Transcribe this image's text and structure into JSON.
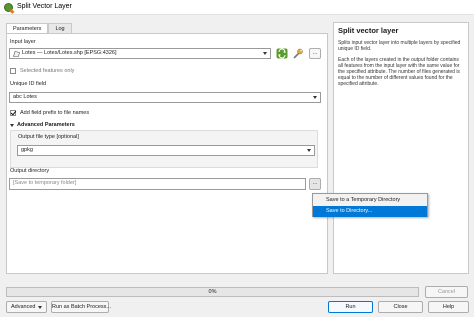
{
  "window": {
    "title": "Split Vector Layer"
  },
  "tabs": [
    {
      "label": "Parameters"
    },
    {
      "label": "Log"
    }
  ],
  "params": {
    "input_layer_label": "Input layer",
    "input_layer_value": "Lotes — Lotes/Lotes.shp [EPSG:4326]",
    "selected_only_label": "Selected features only",
    "unique_id_label": "Unique ID field",
    "unique_id_value": "Lotes",
    "field_type_tag": "abc",
    "add_prefix_label": "Add field prefix to file names",
    "advanced_label": "Advanced Parameters",
    "output_type_label": "Output file type [optional]",
    "output_type_value": "gpkg",
    "output_dir_label": "Output directory",
    "output_dir_placeholder": "[Save to temporary folder]",
    "browse_label": "…"
  },
  "menu": {
    "items": [
      {
        "label": "Save to a Temporary Directory"
      },
      {
        "label": "Save to Directory..."
      }
    ]
  },
  "help": {
    "title": "Split vector layer",
    "p1": "Splits input vector layer into multiple layers by specified unique ID field.",
    "p2": "Each of the layers created in the output folder contains all features from the input layer with the same value for the specified attribute. The number of files generated is equal to the number of different values found for the specified attribute."
  },
  "progress": {
    "value": 0,
    "text": "0%"
  },
  "buttons": {
    "cancel": "Cancel",
    "advanced": "Advanced",
    "batch": "Run as Batch Process...",
    "run": "Run",
    "close": "Close",
    "help": "Help"
  },
  "colors": {
    "accent": "#0078d7",
    "qgis_green": "#589632"
  }
}
